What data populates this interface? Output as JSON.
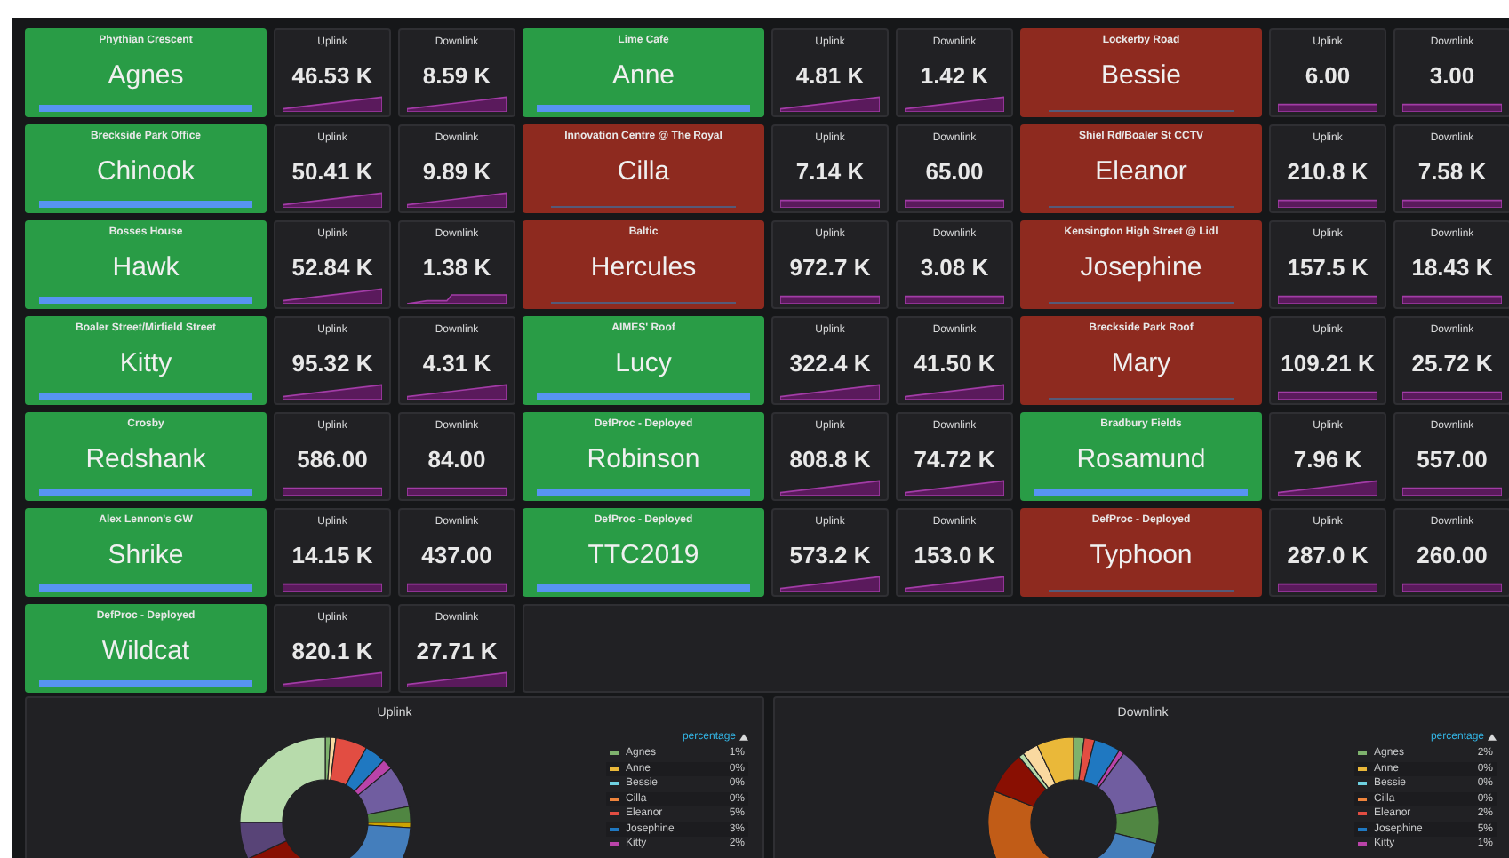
{
  "sites": [
    {
      "location": "Phythian Crescent",
      "name": "Agnes",
      "online": true,
      "uplink": {
        "label": "Uplink",
        "value": "46.53 K",
        "kind": "rising"
      },
      "downlink": {
        "label": "Downlink",
        "value": "8.59 K",
        "kind": "rising"
      }
    },
    {
      "location": "Lime Cafe",
      "name": "Anne",
      "online": true,
      "uplink": {
        "label": "Uplink",
        "value": "4.81 K",
        "kind": "rising"
      },
      "downlink": {
        "label": "Downlink",
        "value": "1.42 K",
        "kind": "rising"
      }
    },
    {
      "location": "Lockerby Road",
      "name": "Bessie",
      "online": false,
      "uplink": {
        "label": "Uplink",
        "value": "6.00",
        "kind": "flat"
      },
      "downlink": {
        "label": "Downlink",
        "value": "3.00",
        "kind": "flat"
      }
    },
    {
      "location": "Breckside Park Office",
      "name": "Chinook",
      "online": true,
      "uplink": {
        "label": "Uplink",
        "value": "50.41 K",
        "kind": "rising"
      },
      "downlink": {
        "label": "Downlink",
        "value": "9.89 K",
        "kind": "rising"
      }
    },
    {
      "location": "Innovation Centre @ The Royal",
      "name": "Cilla",
      "online": false,
      "uplink": {
        "label": "Uplink",
        "value": "7.14 K",
        "kind": "flat"
      },
      "downlink": {
        "label": "Downlink",
        "value": "65.00",
        "kind": "flat"
      }
    },
    {
      "location": "Shiel Rd/Boaler St CCTV",
      "name": "Eleanor",
      "online": false,
      "uplink": {
        "label": "Uplink",
        "value": "210.8 K",
        "kind": "flat"
      },
      "downlink": {
        "label": "Downlink",
        "value": "7.58 K",
        "kind": "flat"
      }
    },
    {
      "location": "Bosses House",
      "name": "Hawk",
      "online": true,
      "uplink": {
        "label": "Uplink",
        "value": "52.84 K",
        "kind": "rising"
      },
      "downlink": {
        "label": "Downlink",
        "value": "1.38 K",
        "kind": "step"
      }
    },
    {
      "location": "Baltic",
      "name": "Hercules",
      "online": false,
      "uplink": {
        "label": "Uplink",
        "value": "972.7 K",
        "kind": "flat"
      },
      "downlink": {
        "label": "Downlink",
        "value": "3.08 K",
        "kind": "flat"
      }
    },
    {
      "location": "Kensington High Street @ Lidl",
      "name": "Josephine",
      "online": false,
      "uplink": {
        "label": "Uplink",
        "value": "157.5 K",
        "kind": "flat"
      },
      "downlink": {
        "label": "Downlink",
        "value": "18.43 K",
        "kind": "flat"
      }
    },
    {
      "location": "Boaler Street/Mirfield Street",
      "name": "Kitty",
      "online": true,
      "uplink": {
        "label": "Uplink",
        "value": "95.32 K",
        "kind": "rising"
      },
      "downlink": {
        "label": "Downlink",
        "value": "4.31 K",
        "kind": "rising"
      }
    },
    {
      "location": "AIMES' Roof",
      "name": "Lucy",
      "online": true,
      "uplink": {
        "label": "Uplink",
        "value": "322.4 K",
        "kind": "rising"
      },
      "downlink": {
        "label": "Downlink",
        "value": "41.50 K",
        "kind": "rising"
      }
    },
    {
      "location": "Breckside Park Roof",
      "name": "Mary",
      "online": false,
      "uplink": {
        "label": "Uplink",
        "value": "109.21 K",
        "kind": "flat"
      },
      "downlink": {
        "label": "Downlink",
        "value": "25.72 K",
        "kind": "flat"
      }
    },
    {
      "location": "Crosby",
      "name": "Redshank",
      "online": true,
      "uplink": {
        "label": "Uplink",
        "value": "586.00",
        "kind": "flat"
      },
      "downlink": {
        "label": "Downlink",
        "value": "84.00",
        "kind": "flat"
      }
    },
    {
      "location": "DefProc - Deployed",
      "name": "Robinson",
      "online": true,
      "uplink": {
        "label": "Uplink",
        "value": "808.8 K",
        "kind": "rising"
      },
      "downlink": {
        "label": "Downlink",
        "value": "74.72 K",
        "kind": "rising"
      }
    },
    {
      "location": "Bradbury Fields",
      "name": "Rosamund",
      "online": true,
      "uplink": {
        "label": "Uplink",
        "value": "7.96 K",
        "kind": "rising"
      },
      "downlink": {
        "label": "Downlink",
        "value": "557.00",
        "kind": "flat"
      }
    },
    {
      "location": "Alex Lennon's GW",
      "name": "Shrike",
      "online": true,
      "uplink": {
        "label": "Uplink",
        "value": "14.15 K",
        "kind": "flat"
      },
      "downlink": {
        "label": "Downlink",
        "value": "437.00",
        "kind": "flat"
      }
    },
    {
      "location": "DefProc - Deployed",
      "name": "TTC2019",
      "online": true,
      "uplink": {
        "label": "Uplink",
        "value": "573.2 K",
        "kind": "rising"
      },
      "downlink": {
        "label": "Downlink",
        "value": "153.0 K",
        "kind": "rising"
      }
    },
    {
      "location": "DefProc - Deployed",
      "name": "Typhoon",
      "online": false,
      "uplink": {
        "label": "Uplink",
        "value": "287.0 K",
        "kind": "flat"
      },
      "downlink": {
        "label": "Downlink",
        "value": "260.00",
        "kind": "flat"
      }
    },
    {
      "location": "DefProc - Deployed",
      "name": "Wildcat",
      "online": true,
      "uplink": {
        "label": "Uplink",
        "value": "820.1 K",
        "kind": "rising"
      },
      "downlink": {
        "label": "Downlink",
        "value": "27.71 K",
        "kind": "rising"
      }
    }
  ],
  "pies": [
    {
      "title": "Uplink",
      "legend_header": "percentage",
      "legend": [
        {
          "name": "Agnes",
          "value": "1%",
          "color": "#7eb26d"
        },
        {
          "name": "Anne",
          "value": "0%",
          "color": "#eab839"
        },
        {
          "name": "Bessie",
          "value": "0%",
          "color": "#6ed0e0"
        },
        {
          "name": "Cilla",
          "value": "0%",
          "color": "#ef843c"
        },
        {
          "name": "Eleanor",
          "value": "5%",
          "color": "#e24d42"
        },
        {
          "name": "Josephine",
          "value": "3%",
          "color": "#1f78c1"
        },
        {
          "name": "Kitty",
          "value": "2%",
          "color": "#ba43a9"
        }
      ]
    },
    {
      "title": "Downlink",
      "legend_header": "percentage",
      "legend": [
        {
          "name": "Agnes",
          "value": "2%",
          "color": "#7eb26d"
        },
        {
          "name": "Anne",
          "value": "0%",
          "color": "#eab839"
        },
        {
          "name": "Bessie",
          "value": "0%",
          "color": "#6ed0e0"
        },
        {
          "name": "Cilla",
          "value": "0%",
          "color": "#ef843c"
        },
        {
          "name": "Eleanor",
          "value": "2%",
          "color": "#e24d42"
        },
        {
          "name": "Josephine",
          "value": "5%",
          "color": "#1f78c1"
        },
        {
          "name": "Kitty",
          "value": "1%",
          "color": "#ba43a9"
        }
      ]
    }
  ]
}
